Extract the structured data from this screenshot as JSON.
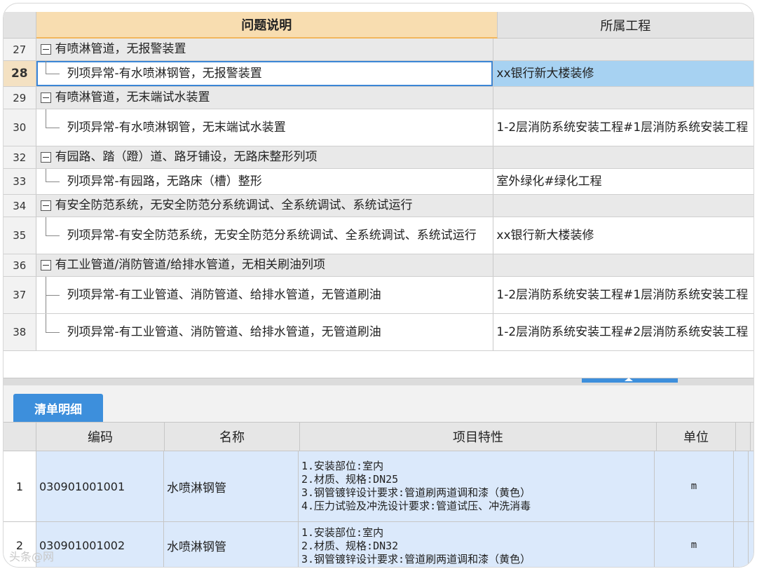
{
  "issues": {
    "headers": {
      "description": "问题说明",
      "project": "所属工程"
    },
    "rows": [
      {
        "num": "27",
        "type": "group",
        "text": "有喷淋管道，无报警装置",
        "project": ""
      },
      {
        "num": "28",
        "type": "child",
        "selected": true,
        "text": "列项异常-有水喷淋钢管，无报警装置",
        "project": "xx银行新大楼装修"
      },
      {
        "num": "29",
        "type": "group",
        "text": "有喷淋管道，无末端试水装置",
        "project": ""
      },
      {
        "num": "30",
        "type": "child",
        "text": "列项异常-有水喷淋钢管，无末端试水装置",
        "project": "1-2层消防系统安装工程#1层消防系统安装工程"
      },
      {
        "num": "32",
        "type": "group",
        "text": "有园路、踏（蹬）道、路牙铺设，无路床整形列项",
        "project": ""
      },
      {
        "num": "33",
        "type": "child",
        "text": "列项异常-有园路，无路床（槽）整形",
        "project": "室外绿化#绿化工程"
      },
      {
        "num": "34",
        "type": "group",
        "text": "有安全防范系统，无安全防范分系统调试、全系统调试、系统试运行",
        "project": ""
      },
      {
        "num": "35",
        "type": "child",
        "text": "列项异常-有安全防范系统，无安全防范分系统调试、全系统调试、系统试运行",
        "project": "xx银行新大楼装修"
      },
      {
        "num": "36",
        "type": "group",
        "text": "有工业管道/消防管道/给排水管道，无相关刷油列项",
        "project": ""
      },
      {
        "num": "37",
        "type": "child",
        "text": "列项异常-有工业管道、消防管道、给排水管道，无管道刷油",
        "project": "1-2层消防系统安装工程#1层消防系统安装工程"
      },
      {
        "num": "38",
        "type": "child",
        "text": "列项异常-有工业管道、消防管道、给排水管道，无管道刷油",
        "project": "1-2层消防系统安装工程#2层消防系统安装工程"
      }
    ]
  },
  "detail": {
    "tab_label": "清单明细",
    "headers": {
      "code": "编码",
      "name": "名称",
      "features": "项目特性",
      "unit": "单位"
    },
    "rows": [
      {
        "idx": "1",
        "code": "030901001001",
        "name": "水喷淋钢管",
        "features": [
          "1.安装部位:室内",
          "2.材质、规格:DN25",
          "3.钢管镀锌设计要求:管道刷两道调和漆（黄色）",
          "4.压力试验及冲洗设计要求:管道试压、冲洗消毒"
        ],
        "unit": "m"
      },
      {
        "idx": "2",
        "code": "030901001002",
        "name": "水喷淋钢管",
        "features": [
          "1.安装部位:室内",
          "2.材质、规格:DN32",
          "3.钢管镀锌设计要求:管道刷两道调和漆（黄色）"
        ],
        "unit": "m"
      }
    ]
  },
  "watermark": "头条@网"
}
